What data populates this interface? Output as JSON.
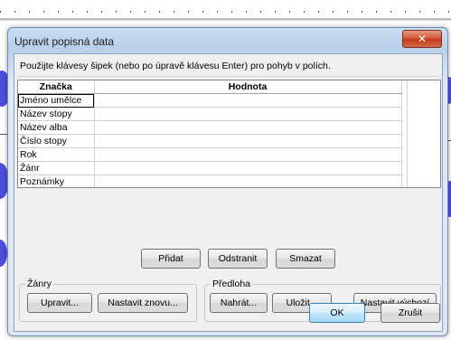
{
  "dialog": {
    "title": "Upravit popisná data",
    "close_symbol": "✕",
    "instruction": "Použijte klávesy šipek (nebo po úpravě klávesu Enter) pro pohyb v polích."
  },
  "grid": {
    "headers": [
      "Značka",
      "Hodnota"
    ],
    "rows": [
      {
        "tag": "Jméno umělce",
        "value": ""
      },
      {
        "tag": "Název stopy",
        "value": ""
      },
      {
        "tag": "Název alba",
        "value": ""
      },
      {
        "tag": "Číslo stopy",
        "value": ""
      },
      {
        "tag": "Rok",
        "value": ""
      },
      {
        "tag": "Žánr",
        "value": ""
      },
      {
        "tag": "Poznámky",
        "value": ""
      },
      {
        "tag": "",
        "value": ""
      }
    ]
  },
  "buttons": {
    "add": "Přidat",
    "remove": "Odstranit",
    "clear": "Smazat",
    "ok": "OK",
    "cancel": "Zrušit"
  },
  "genres": {
    "label": "Žánry",
    "edit": "Upravit...",
    "reset": "Nastavit znovu..."
  },
  "template": {
    "label": "Předloha",
    "load": "Nahrát...",
    "save": "Uložit...",
    "set_default": "Nastavit výchozí"
  }
}
